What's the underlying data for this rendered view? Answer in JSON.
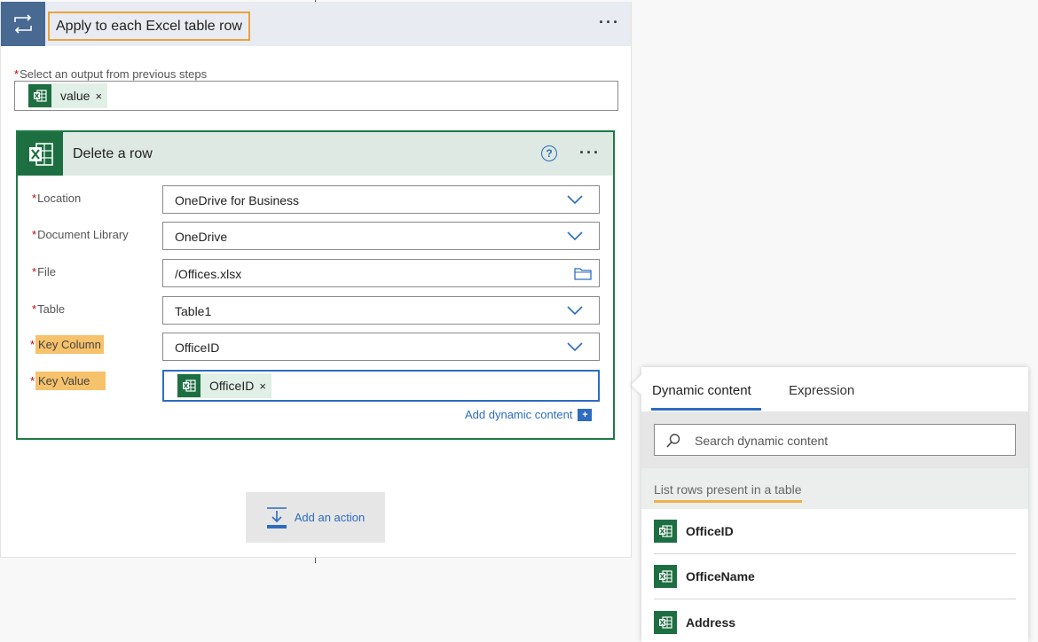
{
  "apply_each": {
    "title": "Apply to each Excel table row",
    "menu": "···",
    "output_label": "Select an output from previous steps",
    "required_mark": "*",
    "token_label": "value",
    "token_close": "×"
  },
  "delete_row": {
    "title": "Delete a row",
    "help": "?",
    "menu": "···",
    "fields": [
      {
        "label": "Location",
        "value": "OneDrive for Business",
        "control": "dropdown"
      },
      {
        "label": "Document Library",
        "value": "OneDrive",
        "control": "dropdown"
      },
      {
        "label": "File",
        "value": "/Offices.xlsx",
        "control": "file-picker"
      },
      {
        "label": "Table",
        "value": "Table1",
        "control": "dropdown"
      },
      {
        "label": "Key Column",
        "value": "OfficeID",
        "control": "dropdown"
      },
      {
        "label": "Key Value",
        "token": "OfficeID",
        "control": "token-input"
      }
    ],
    "token_close": "×",
    "add_dynamic": "Add dynamic content",
    "add_dynamic_plus": "+"
  },
  "add_action": {
    "label": "Add an action"
  },
  "dynamic_panel": {
    "tabs": [
      "Dynamic content",
      "Expression"
    ],
    "search_placeholder": "Search dynamic content",
    "section": "List rows present in a table",
    "items": [
      "OfficeID",
      "OfficeName",
      "Address"
    ]
  },
  "colors": {
    "accent_blue": "#2d6cbf",
    "excel_green": "#1d6f42",
    "highlight_orange": "#e8a33d",
    "loop_blue": "#486991"
  },
  "icons": {
    "loop": "loop-icon",
    "excel": "excel-icon",
    "chevron": "chevron-down-icon",
    "folder": "folder-icon",
    "search": "search-icon",
    "add_action": "add-action-icon"
  }
}
